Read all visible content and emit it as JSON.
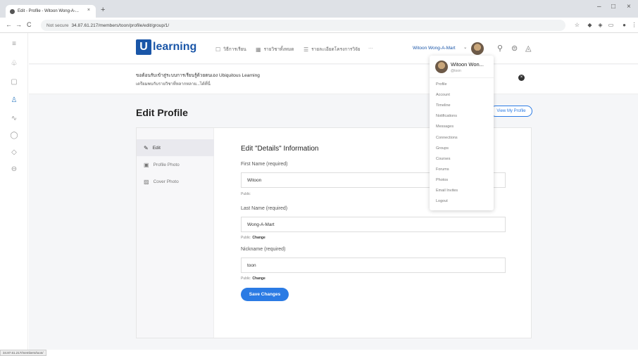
{
  "browser": {
    "tab_title": "Edit - Profile - Witoon Wong-A-...",
    "tab_close": "×",
    "new_tab": "+",
    "back": "←",
    "forward": "→",
    "reload": "C",
    "security": "Not secure",
    "url": "34.87.61.217/members/toon/profile/edit/group/1/",
    "minimize": "–",
    "maximize": "□",
    "close": "×",
    "status_url": "34.87.61.217/members/toon/"
  },
  "nav": {
    "logo_letter": "U",
    "logo_text": "learning",
    "items": [
      {
        "label": "วิธีการเรียน",
        "icon": "☐"
      },
      {
        "label": "รายวิชาทั้งหมด",
        "icon": "▦"
      },
      {
        "label": "รายละเอียดโครงการวิจัย",
        "icon": "☰"
      }
    ],
    "more": "···",
    "username": "Witoon Wong-A-Mart",
    "caret": "⌄"
  },
  "notice": {
    "line1": "ขอต้อนรับเข้าสู่ระบบการเรียนรู้ด้วยตนเอง Ubiquitous Learning",
    "line2": "เตรียมพบกับรายวิชาที่หลากหลาย...ได้ที่นี่",
    "close": "×"
  },
  "page": {
    "title": "Edit Profile",
    "view_btn": "View My Profile"
  },
  "sidebar": {
    "items": [
      {
        "label": "Edit",
        "icon": "✎"
      },
      {
        "label": "Profile Photo",
        "icon": "▣"
      },
      {
        "label": "Cover Photo",
        "icon": "▨"
      }
    ]
  },
  "form": {
    "title": "Edit \"Details\" Information",
    "first_label": "First Name (required)",
    "first_value": "Witoon",
    "first_vis": "Public",
    "last_label": "Last Name (required)",
    "last_value": "Wong-A-Mart",
    "last_vis": "Public",
    "last_change": "Change",
    "nick_label": "Nickname (required)",
    "nick_value": "toon",
    "nick_vis": "Public",
    "nick_change": "Change",
    "save": "Save Changes"
  },
  "dropdown": {
    "name": "Witoon Won...",
    "handle": "@toon",
    "items": [
      "Profile",
      "Account",
      "Timeline",
      "Notifications",
      "Messages",
      "Connections",
      "Groups",
      "Courses",
      "Forums",
      "Photos",
      "Email Invites",
      "Logout"
    ]
  }
}
